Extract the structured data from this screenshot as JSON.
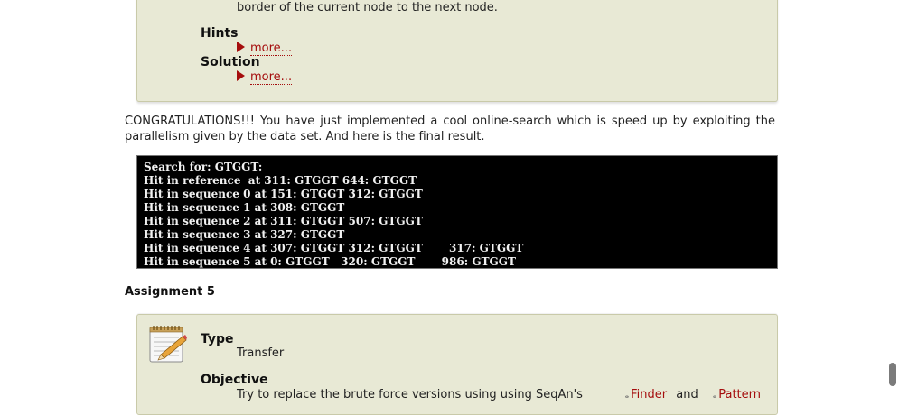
{
  "top_box": {
    "objective_tail": "border of the current node to the next node.",
    "hints_label": "Hints",
    "hints_more": "more...",
    "solution_label": "Solution",
    "solution_more": "more..."
  },
  "congrats": "CONGRATULATIONS!!! You have just implemented a cool online-search which is speed up by exploiting the parallelism given by the data set. And here is the final result.",
  "console_lines": [
    "Search for: GTGGT:",
    "Hit in reference  at 311: GTGGT 644: GTGGT",
    "Hit in sequence 0 at 151: GTGGT 312: GTGGT",
    "Hit in sequence 1 at 308: GTGGT",
    "Hit in sequence 2 at 311: GTGGT 507: GTGGT",
    "Hit in sequence 3 at 327: GTGGT",
    "Hit in sequence 4 at 307: GTGGT 312: GTGGT       317: GTGGT",
    "Hit in sequence 5 at 0: GTGGT   320: GTGGT       986: GTGGT"
  ],
  "assignment_heading": "Assignment 5",
  "bottom_box": {
    "icon": "notepad-pencil-icon",
    "type_label": "Type",
    "type_value": "Transfer",
    "objective_label": "Objective",
    "objective_text": "Try to replace the brute force versions using using SeqAn's",
    "finder_link": "Finder",
    "and_text": "and",
    "pattern_link": "Pattern",
    "link_icon": "book-icon"
  },
  "colors": {
    "box_bg": "#e8e9d5",
    "link": "#a50d0d",
    "console_bg": "#000000"
  }
}
